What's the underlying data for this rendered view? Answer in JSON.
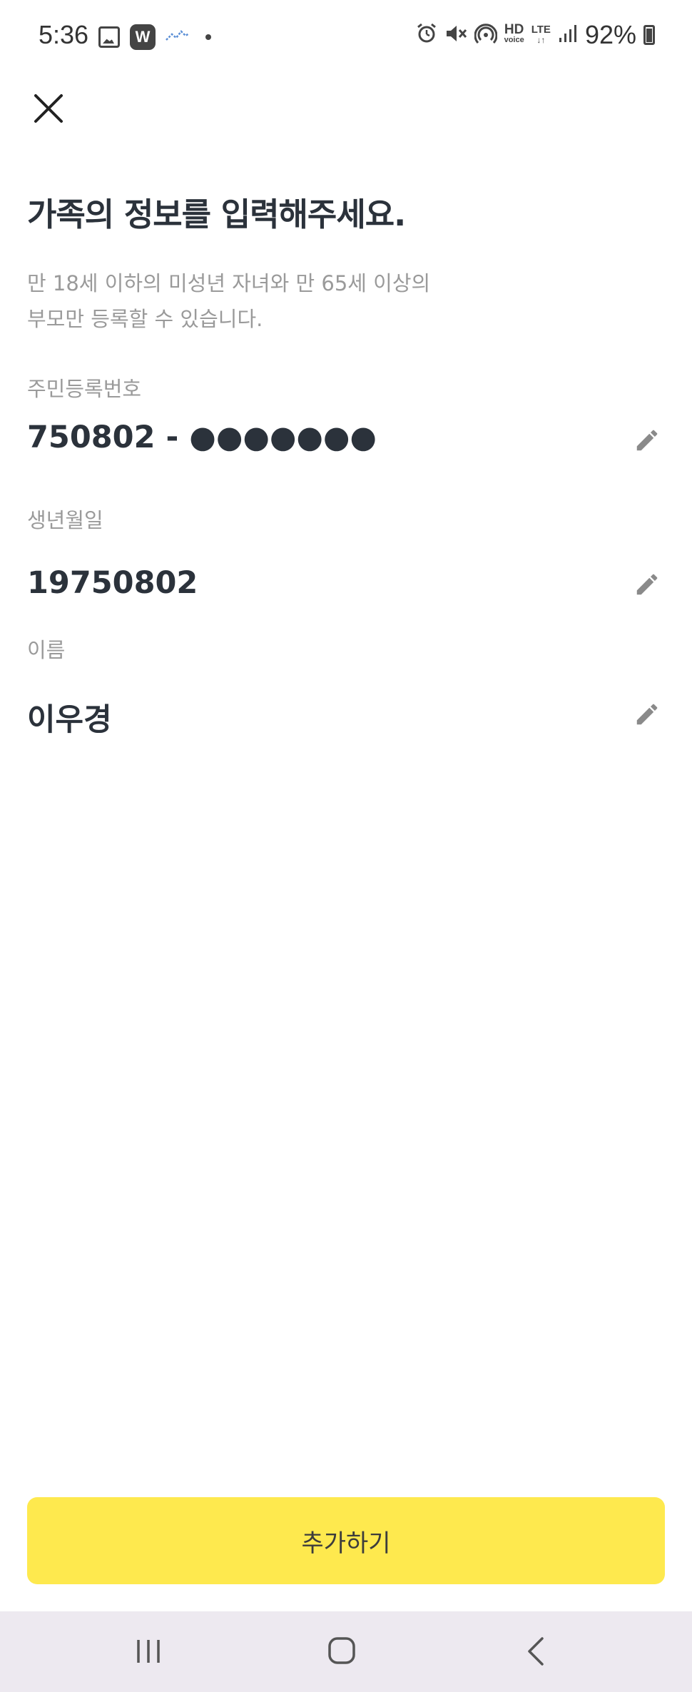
{
  "status_bar": {
    "time": "5:36",
    "w_badge": "W",
    "hd_label": "HD",
    "hd_sub": "voice",
    "lte_label": "LTE",
    "battery": "92%",
    "icons": [
      "gallery-icon",
      "w-app-icon",
      "activity-icon",
      "dot-icon",
      "alarm-icon",
      "mute-icon",
      "hotspot-icon",
      "hd-voice-icon",
      "lte-icon",
      "signal-icon",
      "battery-icon"
    ]
  },
  "header": {
    "close_icon": "close-icon"
  },
  "page": {
    "title": "가족의 정보를 입력해주세요.",
    "description_line1": "만 18세 이하의 미성년 자녀와 만 65세 이상의",
    "description_line2": "부모만 등록할 수 있습니다."
  },
  "fields": {
    "resident_number": {
      "label": "주민등록번호",
      "value": "750802 - ●●●●●●●"
    },
    "birth_date": {
      "label": "생년월일",
      "value": "19750802"
    },
    "name": {
      "label": "이름",
      "value": "이우경"
    },
    "edit_icon": "pencil-icon"
  },
  "footer": {
    "add_button_label": "추가하기"
  },
  "nav_bar": {
    "icons": [
      "recent-apps-icon",
      "home-icon",
      "back-icon"
    ]
  },
  "colors": {
    "accent": "#fee94e",
    "title": "#2b323b",
    "secondary_text": "#9a9a9a",
    "nav_background": "#ede9f0"
  }
}
